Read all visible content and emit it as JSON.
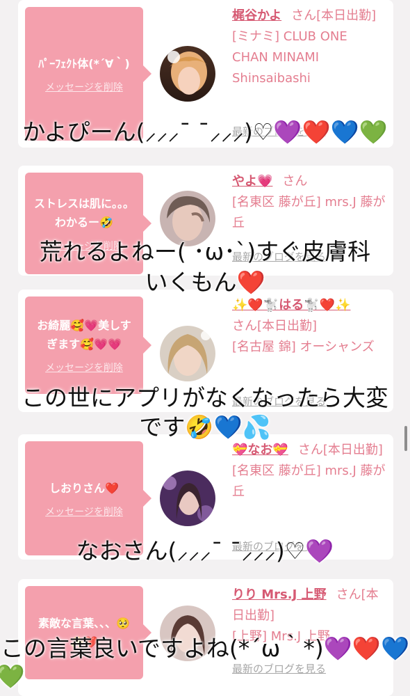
{
  "common": {
    "delete_label": "メッセージを削除",
    "blog_label": "最新のブログを見る"
  },
  "cards": [
    {
      "message": "ﾊﾟｰﾌｪｸﾄ体(*´∀｀)",
      "name": "梶谷かよ",
      "san": "さん[本日出勤]",
      "shop": "[ミナミ] CLUB ONE CHAN MINAMI Shinsaibashi"
    },
    {
      "message": "ストレスは肌に。。。わかるー🤣",
      "name": "やよ💗",
      "san": "さん",
      "shop": "[名東区 藤が丘] mrs.J 藤が丘"
    },
    {
      "message": "お綺麗🥰💗美しすぎます🥰💗💗",
      "name": "✨❤️🐩はる🐩❤️✨",
      "san": "さん[本日出勤]",
      "shop": "[名古屋 錦] オーシャンズ"
    },
    {
      "message": "しおりさん❤️",
      "name": "💝なお💝",
      "san": "さん[本日出勤]",
      "shop": "[名東区 藤が丘] mrs.J 藤が丘"
    },
    {
      "message": "素敵な言葉、、、🥺✨❤️",
      "name": "りり Mrs.J 上野",
      "san": "さん[本日出勤]",
      "shop": "[上野] Mrs.J 上野"
    }
  ],
  "overlays": [
    {
      "text": "かよぴーん(⸝⸝⸝¯ ¯⸝⸝⸝)♡💜❤️💙💚"
    },
    {
      "text": "荒れるよねー(   ･ω･`)すぐ皮膚科"
    },
    {
      "text": "いくもん❤️"
    },
    {
      "text": "この世にアプリがなくなったら大変"
    },
    {
      "text": "です🤣💙💦"
    },
    {
      "text": "なおさん(⸝⸝⸝¯ ¯⸝⸝⸝)♡💜"
    },
    {
      "text": "この言葉良いですよね(*´ω｀*)💜❤️💙"
    },
    {
      "text": "💚"
    }
  ],
  "colors": {
    "bubble": "#f4a0ad",
    "name": "#d65a73",
    "text": "#e47e90",
    "link_gray": "#a7a7a7"
  }
}
